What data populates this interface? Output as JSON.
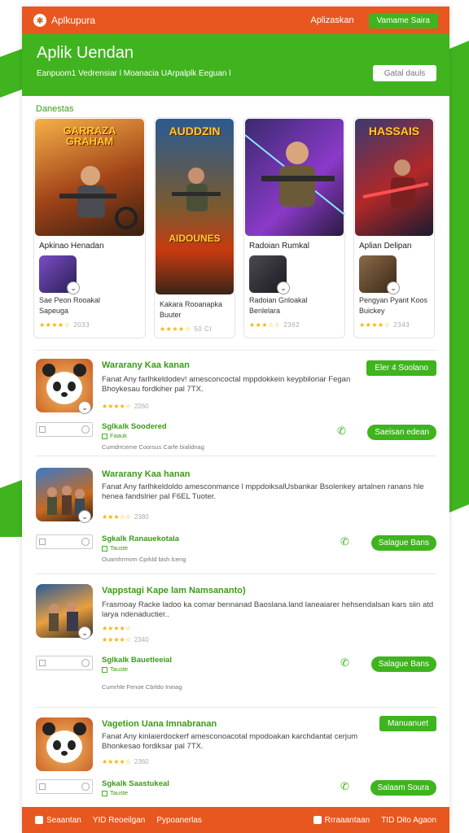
{
  "topbar": {
    "brand": "Aplkupura",
    "nav_link": "Aplizaskan",
    "button": "Vamame Saira"
  },
  "hero": {
    "title": "Aplik Uendan",
    "subtitle": "Eanpuom1 Vedrensiar l Moanacia UArpalplk Eeguan l",
    "button": "Gatal dauls"
  },
  "featured": {
    "section_title": "Danestas",
    "cards": [
      {
        "art_title": "GARRAZA GRAHAM",
        "name": "Apkinao Henadan",
        "sub1": "Sae Peon Rooakal",
        "sub2": "Sapeuga",
        "stars": "★★★★☆",
        "count": "2033"
      },
      {
        "art_title": "AUDDZIN",
        "art_sub": "AIDOUNES",
        "name": "",
        "sub1": "Kakara Rooanapka",
        "sub2": "Buuter",
        "stars": "★★★★☆",
        "count": "50 CI"
      },
      {
        "art_title": "",
        "name": "Radoian Rumkal",
        "sub1": "Radoian Gnloakal",
        "sub2": "Benlelara",
        "stars": "★★★☆☆",
        "count": "2362"
      },
      {
        "art_title": "HASSAIS",
        "name": "Aplian Delipan",
        "sub1": "Pengyan Pyant Koos",
        "sub2": "Buickey",
        "stars": "★★★★☆",
        "count": "2343"
      }
    ]
  },
  "list": [
    {
      "title": "Wararany Kaa kanan",
      "desc": "Fanat Any farlhkeldodev! amesconcoctal mppdokkein keypbiloriar Fegan Bhoykesau fordkiher pal 7TX.",
      "stars": "★★★★☆",
      "count": "2260",
      "badge": "Eler  4 Soolano",
      "dev": "Sglkalk Soodered",
      "dev_sub": "Faauk",
      "action": "Saeisan edean",
      "foot": "Cumdrrceme Coorsus Carfe bialidnag"
    },
    {
      "title": "Wararany Kaa hanan",
      "desc": "Fanat Any farlhkeldoldo amesconmance l mppdoiksalUsbankar Bsolenkey artalnen ranans hle henea fandslrier pal F6EL Tuoter.",
      "stars": "★★★☆☆",
      "count": "2380",
      "badge": "",
      "dev": "Sgkalk Ranauekotala",
      "dev_sub": "Tauste",
      "action": "Salague Bans",
      "foot": "Ouamhrrnvm Cprkld bish lceng"
    },
    {
      "title": "Vappstagi Kape lam Namsananto)",
      "desc": "Frasmoay Racke ladoo ka comar bennanad Baoslana.land laneaiarer hehsendalsan kars siin atd larya ndenaductier..",
      "stars": "★★★★☆",
      "count": "2340",
      "badge": "",
      "dev": "Sglkalk Bauetleeial",
      "dev_sub": "Tauste",
      "action": "Salague Bans",
      "foot": "Cumrhle Fenoe Cbrldo Ineiag"
    },
    {
      "title": "Vagetion Uana Imnabranan",
      "desc": "Fanat Any kinlaierdockerf amesconoacotal mpodoakan karchdantat cerjum Bhonkesao fordiksar pal 7TX.",
      "stars": "★★★★☆",
      "count": "2360",
      "badge": "Manuanuet",
      "dev": "Sgkalk Saastukeal",
      "dev_sub": "Tauste",
      "action": "Salaam Soura",
      "foot": ""
    }
  ],
  "footer": {
    "item1": "Seaantan",
    "item2": "YID Reoeilgan",
    "item3": "Pypoanerlas",
    "item4": "Rrraaantaan",
    "item5": "TID Dito Agaon"
  },
  "colors": {
    "orange": "#e8571f",
    "green": "#3fb41f",
    "green_text": "#3a9b16",
    "star": "#f2b600"
  }
}
